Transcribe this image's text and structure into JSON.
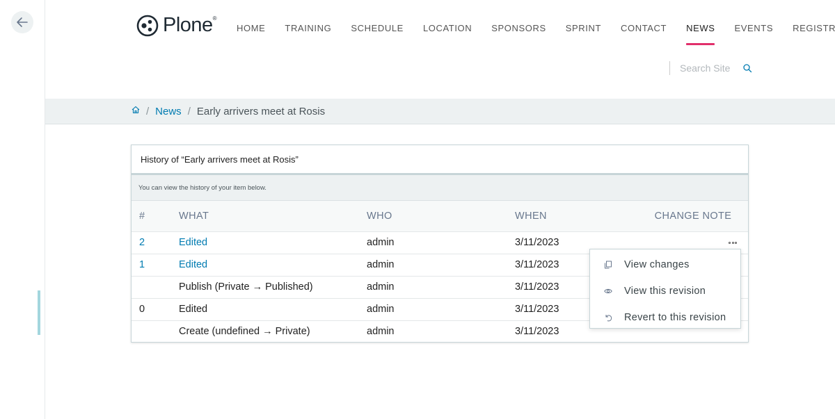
{
  "toolbar": {
    "back_icon": "arrow-left-icon"
  },
  "header": {
    "logo_text": "Plone",
    "logo_reg": "®",
    "nav": [
      {
        "label": "HOME",
        "active": false
      },
      {
        "label": "TRAINING",
        "active": false
      },
      {
        "label": "SCHEDULE",
        "active": false
      },
      {
        "label": "LOCATION",
        "active": false
      },
      {
        "label": "SPONSORS",
        "active": false
      },
      {
        "label": "SPRINT",
        "active": false
      },
      {
        "label": "CONTACT",
        "active": false
      },
      {
        "label": "NEWS",
        "active": true
      },
      {
        "label": "EVENTS",
        "active": false
      },
      {
        "label": "REGISTRATION",
        "active": false
      }
    ],
    "search_placeholder": "Search Site"
  },
  "breadcrumbs": {
    "home_icon": "home-icon",
    "sep": "/",
    "items": [
      "News",
      "Early arrivers meet at Rosis"
    ]
  },
  "history": {
    "title": "History of “Early arrivers meet at Rosis”",
    "description": "You can view the history of your item below.",
    "columns": [
      "#",
      "WHAT",
      "WHO",
      "WHEN",
      "CHANGE NOTE"
    ],
    "rows": [
      {
        "num": "2",
        "what": "Edited",
        "who": "admin",
        "when": "3/11/2023"
      },
      {
        "num": "1",
        "what": "Edited",
        "who": "admin",
        "when": "3/11/2023"
      },
      {
        "num": "",
        "what": "Publish (Private → Published)",
        "who": "admin",
        "when": "3/11/2023"
      },
      {
        "num": "0",
        "what": "Edited",
        "who": "admin",
        "when": "3/11/2023"
      },
      {
        "num": "",
        "what": "Create (undefined → Private)",
        "who": "admin",
        "when": "3/11/2023"
      }
    ]
  },
  "menu": {
    "items": [
      {
        "label": "View changes",
        "icon": "copy-icon"
      },
      {
        "label": "View this revision",
        "icon": "eye-icon"
      },
      {
        "label": "Revert to this revision",
        "icon": "undo-icon"
      }
    ]
  },
  "colors": {
    "accent": "#e12f6b",
    "link": "#007bb1"
  }
}
